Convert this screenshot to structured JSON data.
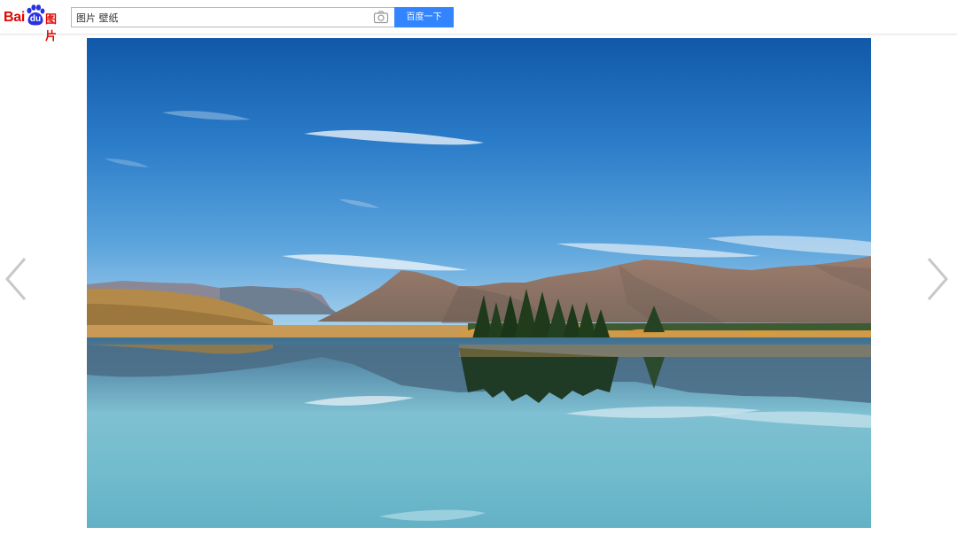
{
  "header": {
    "logo": {
      "text_bai": "Bai",
      "text_du": "du",
      "text_tupian": "图片"
    },
    "search": {
      "value": "图片 壁纸",
      "button_label": "百度一下"
    },
    "icons": {
      "camera": "camera-icon",
      "paw": "baidu-paw-icon"
    }
  },
  "viewer": {
    "image": "landscape-lake-mountains",
    "prev_icon": "chevron-left-icon",
    "next_icon": "chevron-right-icon"
  },
  "colors": {
    "brand_red": "#e10601",
    "brand_blue": "#2932e1",
    "button_blue": "#3385ff",
    "arrow_gray": "#c8c8c8"
  }
}
